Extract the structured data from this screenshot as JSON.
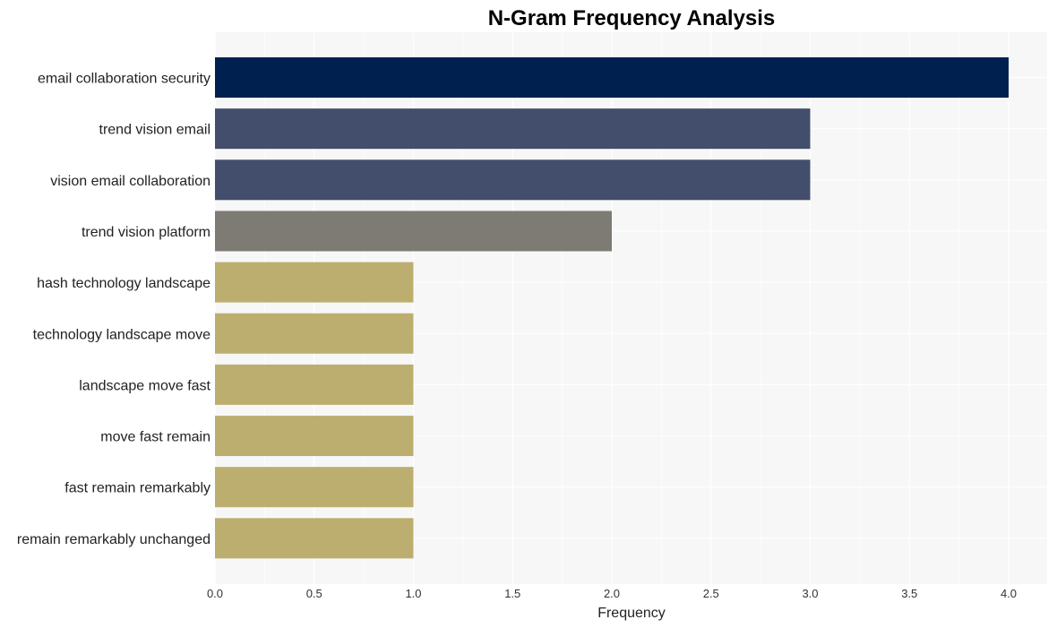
{
  "chart_data": {
    "type": "bar",
    "orientation": "horizontal",
    "title": "N-Gram Frequency Analysis",
    "xlabel": "Frequency",
    "ylabel": "",
    "xlim": [
      0,
      4.2
    ],
    "xticks": [
      "0.0",
      "0.5",
      "1.0",
      "1.5",
      "2.0",
      "2.5",
      "3.0",
      "3.5",
      "4.0"
    ],
    "grid": true,
    "categories": [
      "email collaboration security",
      "trend vision email",
      "vision email collaboration",
      "trend vision platform",
      "hash technology landscape",
      "technology landscape move",
      "landscape move fast",
      "move fast remain",
      "fast remain remarkably",
      "remain remarkably unchanged"
    ],
    "values": [
      4,
      3,
      3,
      2,
      1,
      1,
      1,
      1,
      1,
      1
    ],
    "colors": [
      "#00204f",
      "#434e6c",
      "#434e6c",
      "#7d7b74",
      "#bcae6e",
      "#bcae6e",
      "#bcae6e",
      "#bcae6e",
      "#bcae6e",
      "#bcae6e"
    ],
    "panel_background": "#f7f7f7",
    "grid_color": "#ffffff"
  }
}
